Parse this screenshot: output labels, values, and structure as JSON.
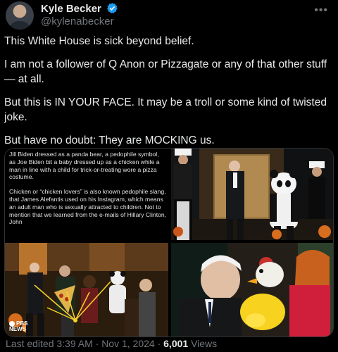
{
  "author": {
    "display_name": "Kyle Becker",
    "handle": "@kylenabecker",
    "verified": true,
    "verified_color": "#1d9bf0"
  },
  "more_icon": "more-horizontal-icon",
  "post": {
    "paragraphs": [
      "This White House is sick beyond belief.",
      "I am not a follower of Q Anon or Pizzagate or any of that other stuff — at all.",
      "But this is IN YOUR FACE. It may be a troll or some kind of twisted joke.",
      "But have no doubt: They are MOCKING us."
    ]
  },
  "media": {
    "caption_paragraphs": [
      "Jill Biden dressed as a panda bear, a pedophile symbol, as Joe Biden bit a baby dressed up as a chicken while a man in line with a child for trick-or-treating wore a pizza costume.",
      "Chicken or “chicken lovers” is also known pedophile slang, that James Alefantis used on his Instagram, which means an adult man who is sexually attracted to children. Not to mention that we learned from the e-mails of Hillary Clinton, John"
    ],
    "watermark_line1": "PBS",
    "watermark_line2": "NEWS"
  },
  "footer": {
    "edited": "Last edited 3:39 AM · Nov 1, 2024 · ",
    "views_count": "6,001",
    "views_label": " Views"
  },
  "colors": {
    "background": "#000000",
    "text_primary": "#e7e9ea",
    "text_secondary": "#71767b",
    "border": "#2f3336"
  }
}
